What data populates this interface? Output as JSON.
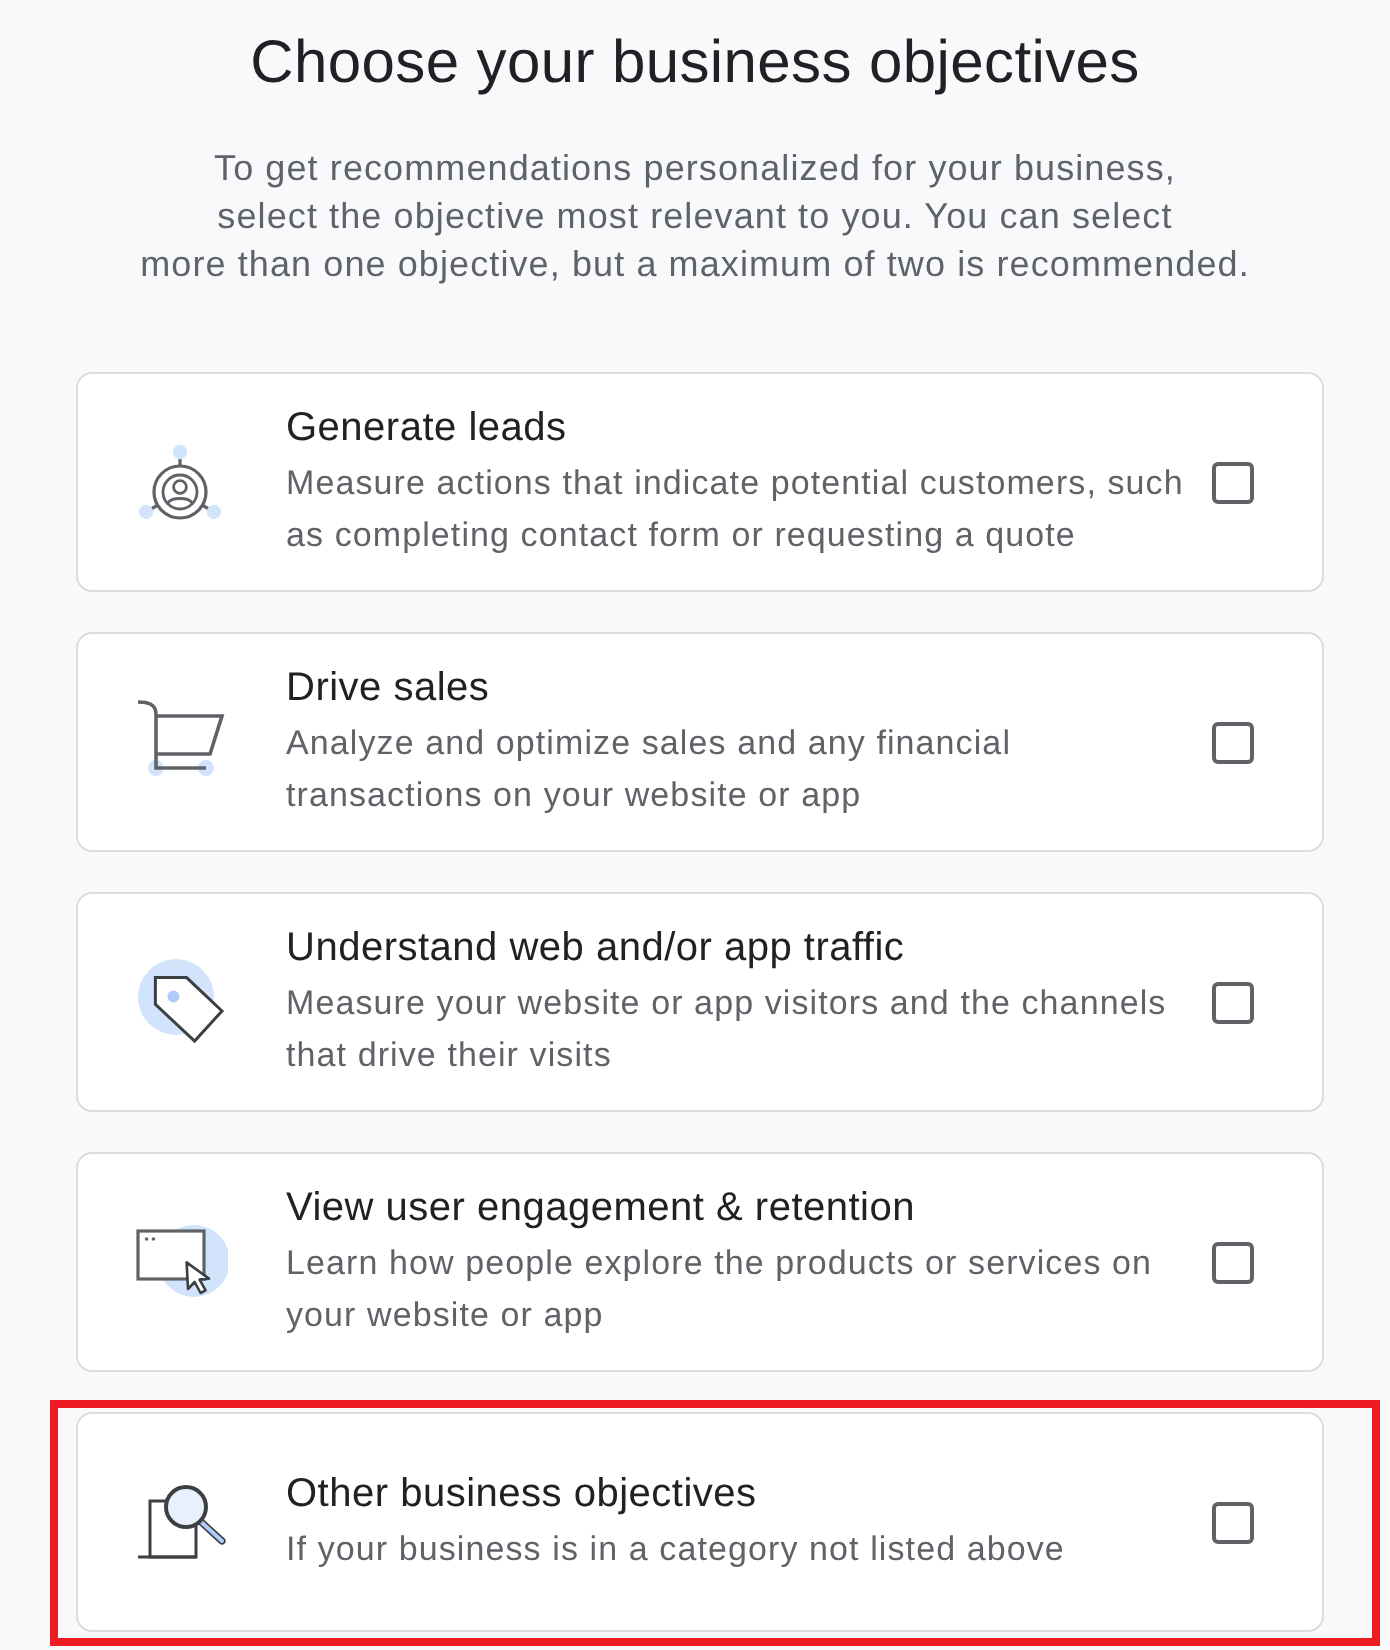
{
  "header": {
    "title": "Choose your business objectives",
    "description_lines": [
      "To get recommendations personalized for your business,",
      "select the objective most relevant to you. You can select",
      "more than one objective, but a maximum of two is recommended."
    ]
  },
  "objectives": [
    {
      "title": "Generate leads",
      "description": "Measure actions that indicate potential customers, such as completing contact form or requesting a quote",
      "checked": false,
      "highlighted": false
    },
    {
      "title": "Drive sales",
      "description": "Analyze and optimize sales and any financial transactions on your website or app",
      "checked": false,
      "highlighted": false
    },
    {
      "title": "Understand web and/or app traffic",
      "description": "Measure your website or app visitors and the channels that drive their visits",
      "checked": false,
      "highlighted": false
    },
    {
      "title": "View user engagement & retention",
      "description": "Learn how people explore the products or services on your website or app",
      "checked": false,
      "highlighted": false
    },
    {
      "title": "Other business objectives",
      "description": "If your business is in a category not listed above",
      "checked": false,
      "highlighted": true
    }
  ]
}
